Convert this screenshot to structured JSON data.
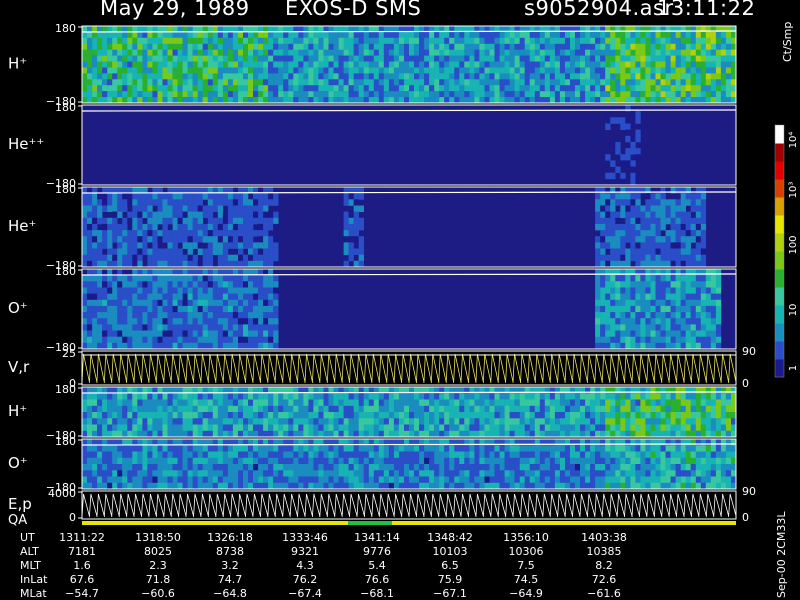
{
  "header": {
    "date": "May 29, 1989",
    "instrument": "EXOS-D SMS",
    "file": "s9052904.asr",
    "time": "13:11:22"
  },
  "colorbar": {
    "unit": "Ct/Smp",
    "ticks": [
      "10⁴",
      "10³",
      "100",
      "10",
      "1"
    ]
  },
  "footer_label": "Sep-00 2CM33L",
  "panels": [
    {
      "label": "H⁺",
      "top": "180",
      "bottom": "−180"
    },
    {
      "label": "He⁺⁺",
      "top": "180",
      "bottom": "−180"
    },
    {
      "label": "He⁺",
      "top": "180",
      "bottom": "−180"
    },
    {
      "label": "O⁺",
      "top": "180",
      "bottom": "−180"
    },
    {
      "label": "V,r",
      "top": "25",
      "bottom": "0",
      "right_top": "90",
      "right_bottom": "0"
    },
    {
      "label": "H⁺",
      "top": "180",
      "bottom": "−180"
    },
    {
      "label": "O⁺",
      "top": "180",
      "bottom": "−180"
    },
    {
      "label": "E,p",
      "top": "4000",
      "bottom": "0",
      "right_top": "90",
      "right_bottom": "0",
      "sub": "QA"
    }
  ],
  "table": {
    "rows": [
      {
        "name": "UT",
        "values": [
          "1311:22",
          "1318:50",
          "1326:18",
          "1333:46",
          "1341:14",
          "1348:42",
          "1356:10",
          "1403:38"
        ]
      },
      {
        "name": "ALT",
        "values": [
          "7181",
          "8025",
          "8738",
          "9321",
          "9776",
          "10103",
          "10306",
          "10385"
        ]
      },
      {
        "name": "MLT",
        "values": [
          "1.6",
          "2.3",
          "3.2",
          "4.3",
          "5.4",
          "6.5",
          "7.5",
          "8.2"
        ]
      },
      {
        "name": "InLat",
        "values": [
          "67.6",
          "71.8",
          "74.7",
          "76.2",
          "76.6",
          "75.9",
          "74.5",
          "72.6"
        ]
      },
      {
        "name": "MLat",
        "values": [
          "−54.7",
          "−60.6",
          "−64.8",
          "−67.4",
          "−68.1",
          "−67.1",
          "−64.9",
          "−61.6"
        ]
      }
    ]
  },
  "chart_data": {
    "type": "heatmap",
    "title": "May 29, 1989   EXOS-D SMS",
    "x": [
      "1311:22",
      "1318:50",
      "1326:18",
      "1333:46",
      "1341:14",
      "1348:42",
      "1356:10",
      "1403:38"
    ],
    "series": [
      {
        "name": "H+",
        "ylim": [
          -180,
          180
        ]
      },
      {
        "name": "He++",
        "ylim": [
          -180,
          180
        ]
      },
      {
        "name": "He+",
        "ylim": [
          -180,
          180
        ]
      },
      {
        "name": "O+",
        "ylim": [
          -180,
          180
        ]
      },
      {
        "name": "V,r",
        "ylim": [
          0,
          25
        ]
      },
      {
        "name": "H+",
        "ylim": [
          -180,
          180
        ]
      },
      {
        "name": "O+",
        "ylim": [
          -180,
          180
        ]
      },
      {
        "name": "E,p",
        "ylim": [
          0,
          4000
        ]
      }
    ],
    "colorscale": [
      "#1a1a8a",
      "#2a4ec8",
      "#1a8cc0",
      "#18b4b4",
      "#38c8a0",
      "#2ab030",
      "#7ac818",
      "#b0d010",
      "#e6e600",
      "#d8a000",
      "#d84000",
      "#e00000",
      "#a00000",
      "#ffffff"
    ]
  }
}
